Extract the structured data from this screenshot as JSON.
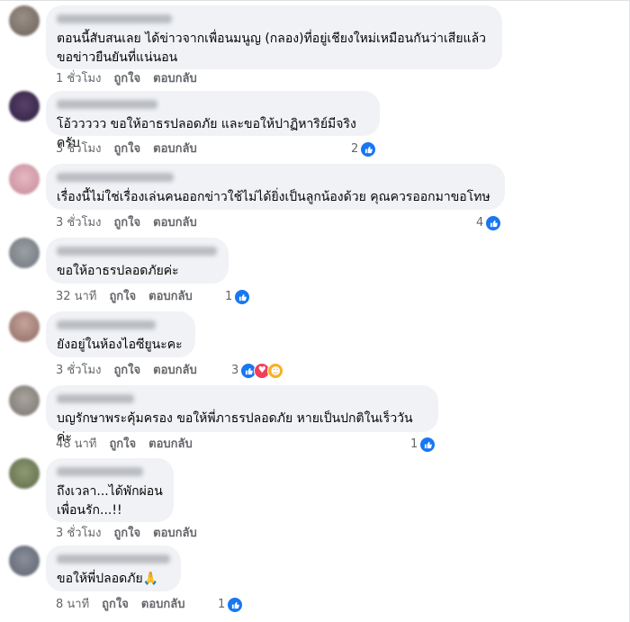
{
  "actions": {
    "like": "ถูกใจ",
    "reply": "ตอบกลับ"
  },
  "comments": [
    {
      "text": "ตอนนี้สับสนเลย ได้ข่าวจากเพื่อนมนูญ (กลอง)ที่อยู่เชียงใหม่เหมือนกันว่าเสียแล้ว\nขอข่าวยืนยันที่แน่นอน",
      "time": "1 ชั่วโมง",
      "reactions": null,
      "reaction_icons": []
    },
    {
      "text": "โอ้ววววว ขอให้อาธรปลอดภัย และขอให้ปาฏิหาริย์มีจริงครับ",
      "time": "3 ชั่วโมง",
      "reactions": "2",
      "reaction_icons": [
        "like-icon"
      ]
    },
    {
      "text": "เรื่องนี้ไม่ใช่เรื่องเล่นคนออกข่าวใช้ไม่ได้ยิ่งเป็นลูกน้องด้วย คุณควรออกมาขอโทษ",
      "time": "3 ชั่วโมง",
      "reactions": "4",
      "reaction_icons": [
        "like-icon"
      ]
    },
    {
      "text": "ขอให้อาธรปลอดภัยค่ะ",
      "time": "32 นาที",
      "reactions": "1",
      "reaction_icons": [
        "like-icon"
      ]
    },
    {
      "text": "ยังอยู่ในห้องไอซียูนะคะ",
      "time": "3 ชั่วโมง",
      "reactions": "3",
      "reaction_icons": [
        "like-icon",
        "love-icon",
        "care-icon"
      ]
    },
    {
      "text": "บญรักษาพระคุ้มครอง ขอให้พี่ภาธรปลอดภัย หายเป็นปกติในเร็ววันค่ะ",
      "time": "48 นาที",
      "reactions": "1",
      "reaction_icons": [
        "like-icon"
      ]
    },
    {
      "text": "ถึงเวลา...ได้พักผ่อน\nเพื่อนรัก...!!",
      "time": "3 ชั่วโมง",
      "reactions": null,
      "reaction_icons": []
    },
    {
      "text": "ขอให้พี่ปลอดภัย🙏",
      "time": "8 นาที",
      "reactions": "1",
      "reaction_icons": [
        "like-icon"
      ]
    }
  ],
  "colors": {
    "bubble": "#f0f2f5",
    "meta_text": "#65676b",
    "like": "#1877f2",
    "love": "#f33e58",
    "care": "#f7b125"
  }
}
